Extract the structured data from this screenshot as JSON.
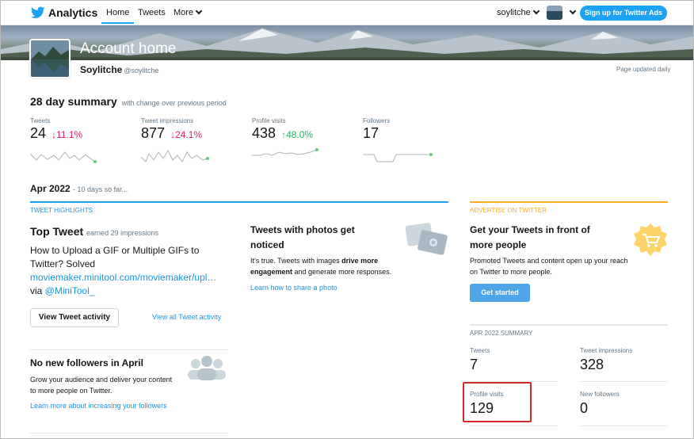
{
  "nav": {
    "brand": "Analytics",
    "home": "Home",
    "tweets": "Tweets",
    "more": "More",
    "user": "soylitche",
    "ads_button": "Sign up for Twitter Ads"
  },
  "header": {
    "title": "Account home",
    "name": "Soylitche",
    "handle": "@soylitche",
    "updated": "Page updated daily"
  },
  "summary": {
    "title": "28 day summary",
    "subtitle": "with change over previous period",
    "metrics": [
      {
        "label": "Tweets",
        "value": "24",
        "delta": "11.1%",
        "direction": "down"
      },
      {
        "label": "Tweet impressions",
        "value": "877",
        "delta": "24.1%",
        "direction": "down"
      },
      {
        "label": "Profile visits",
        "value": "438",
        "delta": "48.0%",
        "direction": "up"
      },
      {
        "label": "Followers",
        "value": "17",
        "delta": "",
        "direction": "none"
      }
    ]
  },
  "month": {
    "title": "Apr 2022",
    "subtitle": "- 10 days so far..."
  },
  "highlights": {
    "label": "TWEET HIGHLIGHTS",
    "top_tweet_title": "Top Tweet",
    "top_tweet_sub": "earned 29 impressions",
    "tweet_line1": "How to Upload a GIF or Multiple GIFs to Twitter? Solved",
    "tweet_link": "moviemaker.minitool.com/moviemaker/upl…",
    "tweet_via": "via",
    "tweet_mention": "@MiniTool_",
    "view_button": "View Tweet activity",
    "view_all": "View all Tweet activity",
    "nofollow_title": "No new followers in April",
    "nofollow_text": "Grow your audience and deliver your content to more people on Twitter.",
    "nofollow_link": "Learn more about increasing your followers",
    "photos_title": "Tweets with photos get noticed",
    "photos_text_1": "It's true. Tweets with images",
    "photos_text_bold": "drive more engagement",
    "photos_text_2": "and generate more responses.",
    "photos_link": "Learn how to share a photo"
  },
  "advertise": {
    "label": "ADVERTISE ON TWITTER",
    "title": "Get your Tweets in front of more people",
    "text": "Promoted Tweets and content open up your reach on Twitter to more people.",
    "button": "Get started"
  },
  "apr_summary": {
    "label": "APR 2022 SUMMARY",
    "stats": [
      {
        "label": "Tweets",
        "value": "7"
      },
      {
        "label": "Tweet impressions",
        "value": "328"
      },
      {
        "label": "Profile visits",
        "value": "129"
      },
      {
        "label": "New followers",
        "value": "0"
      }
    ]
  },
  "colors": {
    "accent": "#1da1f2",
    "down": "#e0245e",
    "up": "#17bf63",
    "ad": "#ffad1f",
    "highlight": "#d9262b"
  }
}
